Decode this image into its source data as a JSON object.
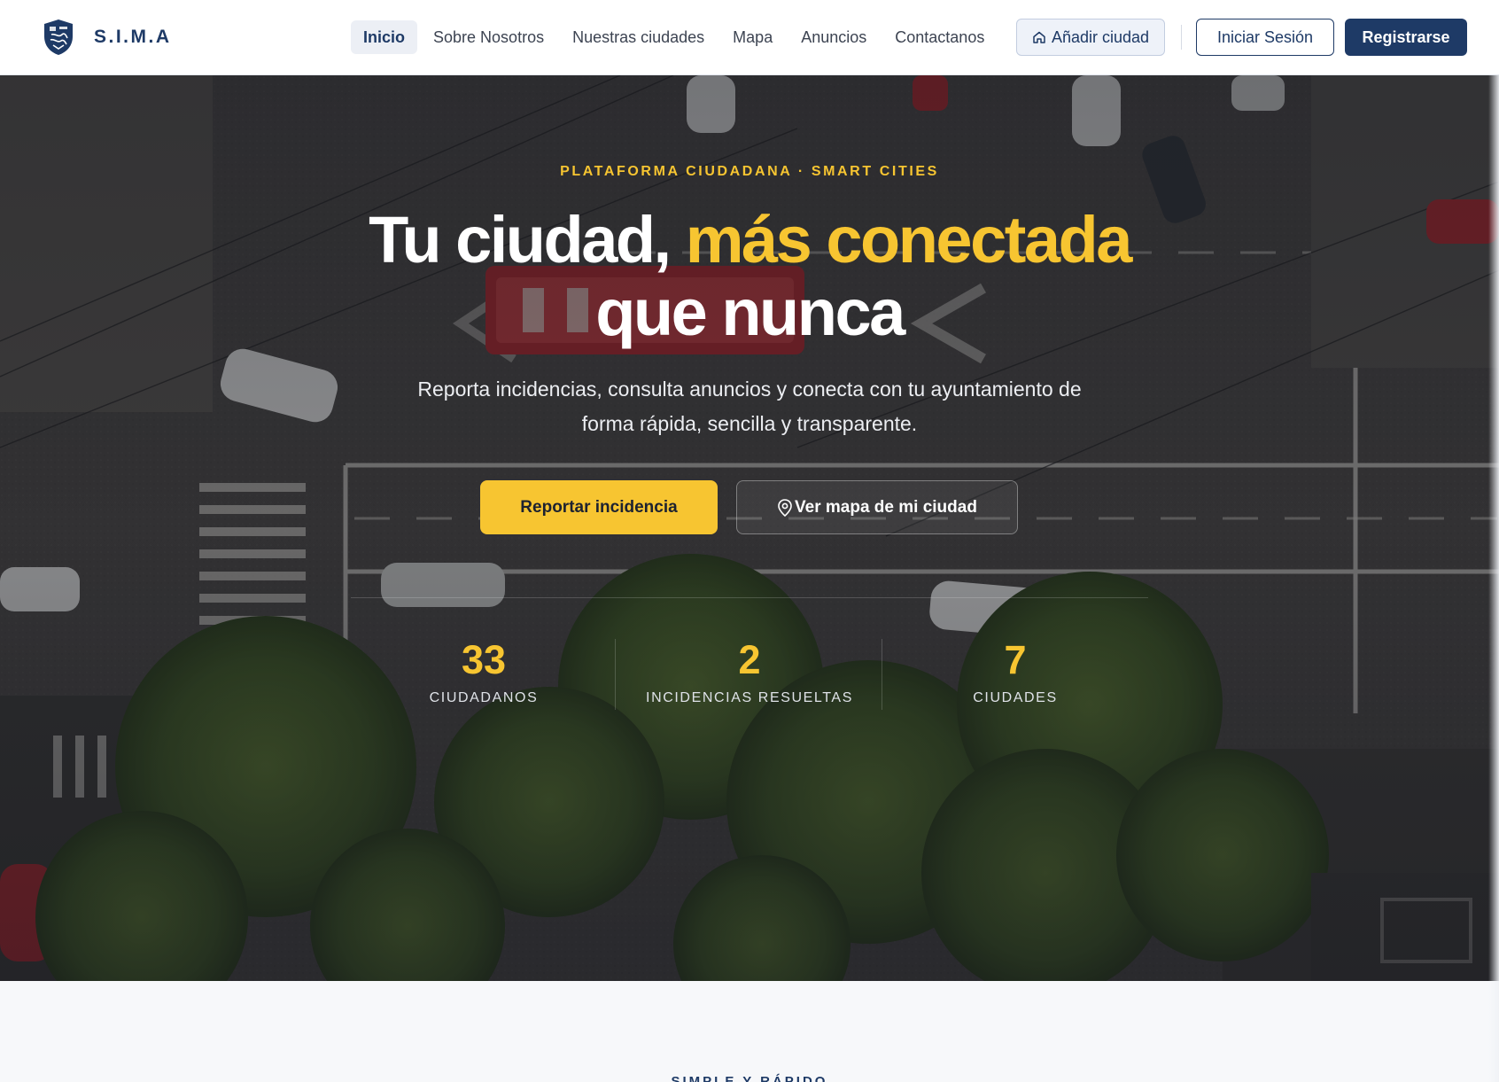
{
  "brand": {
    "name": "S.I.M.A",
    "logo_icon": "shield-city-logo-icon"
  },
  "nav": {
    "links": [
      {
        "label": "Inicio",
        "active": true
      },
      {
        "label": "Sobre Nosotros",
        "active": false
      },
      {
        "label": "Nuestras ciudades",
        "active": false
      },
      {
        "label": "Mapa",
        "active": false
      },
      {
        "label": "Anuncios",
        "active": false
      },
      {
        "label": "Contactanos",
        "active": false
      }
    ],
    "add_city": {
      "label": "Añadir ciudad",
      "icon": "home-icon"
    },
    "login_label": "Iniciar Sesión",
    "register_label": "Registrarse"
  },
  "hero": {
    "eyebrow": "PLATAFORMA CIUDADANA · SMART CITIES",
    "headline_part1": "Tu ciudad, ",
    "headline_highlight": "más conectada",
    "headline_part2": "que nunca",
    "subtitle": "Reporta incidencias, consulta anuncios y conecta con tu ayuntamiento de forma rápida, sencilla y transparente.",
    "cta_primary": "Reportar incidencia",
    "cta_secondary": {
      "label": "Ver mapa de mi ciudad",
      "icon": "map-pin-icon"
    },
    "stats": [
      {
        "value": "33",
        "label": "CIUDADANOS"
      },
      {
        "value": "2",
        "label": "INCIDENCIAS RESUELTAS"
      },
      {
        "value": "7",
        "label": "CIUDADES"
      }
    ]
  },
  "next_section": {
    "eyebrow": "SIMPLE Y RÁPIDO"
  },
  "colors": {
    "primary_navy": "#1e3a66",
    "accent_yellow": "#f7c531",
    "hero_overlay": "#14161e"
  }
}
